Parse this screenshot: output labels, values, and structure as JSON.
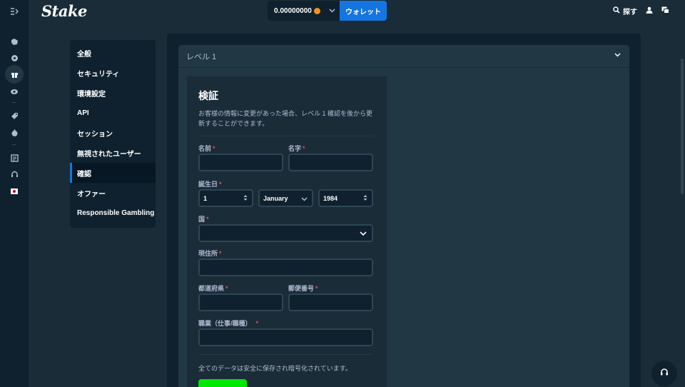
{
  "header": {
    "logo": "Stake",
    "balance": "0.00000000",
    "wallet_label": "ウォレット",
    "search_label": "探す"
  },
  "sidebar_rail": {
    "icons": [
      "expand-menu-icon",
      "casino-icon",
      "sports-icon",
      "rewards-icon",
      "live-icon",
      "promotions-icon",
      "sponsorship-icon",
      "blog-icon",
      "support-icon",
      "language-flag-icon"
    ]
  },
  "settings_nav": {
    "items": [
      {
        "label": "全般"
      },
      {
        "label": "セキュリティ"
      },
      {
        "label": "環境設定"
      },
      {
        "label": "API"
      },
      {
        "label": "セッション"
      },
      {
        "label": "無視されたユーザー"
      },
      {
        "label": "確認"
      },
      {
        "label": "オファー"
      },
      {
        "label": "Responsible Gambling"
      }
    ],
    "active_index": 6
  },
  "level": {
    "title": "レベル 1"
  },
  "form": {
    "title": "検証",
    "description": "お客様の情報に変更があった場合、レベル 1 確認を後から更新することができます。",
    "first_name_label": "名前",
    "last_name_label": "名字",
    "dob_label": "誕生日",
    "dob_day": "1",
    "dob_month": "January",
    "dob_year": "1984",
    "country_label": "国",
    "address_label": "現住所",
    "prefecture_label": "都道府県",
    "postal_label": "郵便番号",
    "occupation_label": "職業（仕事/職種）",
    "required_mark": "*",
    "security_note": "全てのデータは安全に保存され暗号化されています。"
  },
  "colors": {
    "background": "#1a2c38",
    "panel": "#0f212e",
    "card": "#213743",
    "accent_blue": "#1475e1",
    "accent_green": "#00e701",
    "required_red": "#ed4163"
  }
}
